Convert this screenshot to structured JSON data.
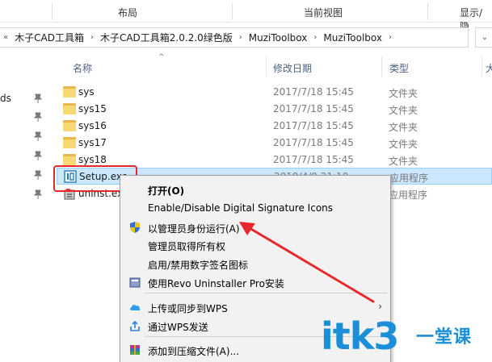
{
  "ribbon": {
    "groups": [
      "布局",
      "当前视图",
      "显示/隐"
    ]
  },
  "address": {
    "crumbs": [
      "木子CAD工具箱",
      "木子CAD工具箱2.0.2.0绿色版",
      "MuziToolbox",
      "MuziToolbox"
    ],
    "lead_chevron": "«",
    "sep_chevron": "›",
    "dropdown": "⌄"
  },
  "nav": {
    "partial_label": "ds"
  },
  "columns": {
    "name": "名称",
    "date": "修改日期",
    "type": "类型",
    "size": "大"
  },
  "files": [
    {
      "name": "sys",
      "date": "2017/7/18 15:45",
      "type": "文件夹"
    },
    {
      "name": "sys15",
      "date": "2017/7/18 15:45",
      "type": "文件夹"
    },
    {
      "name": "sys16",
      "date": "2017/7/18 15:45",
      "type": "文件夹"
    },
    {
      "name": "sys17",
      "date": "2017/7/18 15:45",
      "type": "文件夹"
    },
    {
      "name": "sys18",
      "date": "2017/7/18 15:45",
      "type": "文件夹"
    },
    {
      "name": "Setup.exe",
      "date": "2019/4/9 21:10",
      "type": "应用程序"
    },
    {
      "name": "uninst.exe",
      "date": "",
      "type": "应用程序"
    }
  ],
  "menu": {
    "items": [
      {
        "label": "打开(O)"
      },
      {
        "label": "Enable/Disable Digital Signature Icons"
      },
      {
        "label": "以管理员身份运行(A)"
      },
      {
        "label": "管理员取得所有权"
      },
      {
        "label": "启用/禁用数字签名图标"
      },
      {
        "label": "使用Revo Uninstaller Pro安装"
      },
      {
        "label": "上传或同步到WPS",
        "submenu": "›"
      },
      {
        "label": "通过WPS发送",
        "submenu": "›"
      },
      {
        "label": "添加到压缩文件(A)..."
      }
    ]
  },
  "watermark": {
    "logo": "itk3",
    "tagline": "一堂课"
  },
  "colors": {
    "selection": "#cce8ff",
    "annotation": "#e8272b",
    "watermark": "#1a8fd8"
  }
}
